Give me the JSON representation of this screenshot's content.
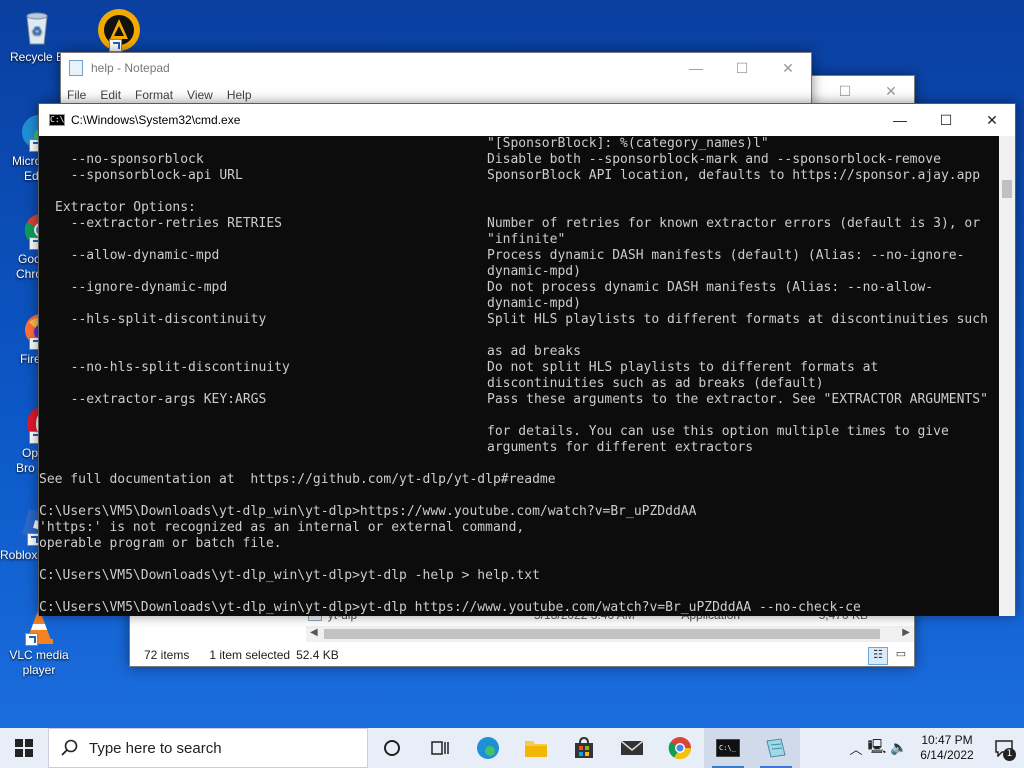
{
  "desktop": {
    "icons": [
      {
        "label": "Recycle Bin",
        "short": "Recycle B"
      },
      {
        "label": "Microsoft Edge",
        "short1": "Micro",
        "short2": "Ed"
      },
      {
        "label": "Google Chrome",
        "short1": "Goo",
        "short2": "Chro"
      },
      {
        "label": "Firefox",
        "short": "Fire"
      },
      {
        "label": "Opera Browser",
        "short1": "Op",
        "short2": "Bro"
      },
      {
        "label": "Roblox",
        "short": "Roblox"
      },
      {
        "label": "VLC media player",
        "short1": "VLC media",
        "short2": "player"
      }
    ]
  },
  "notepad": {
    "title": "help - Notepad",
    "menu": [
      "File",
      "Edit",
      "Format",
      "View",
      "Help"
    ]
  },
  "explorer": {
    "file_row": {
      "name": "yt-dlp",
      "date": "5/18/2022 3:40 AM",
      "type": "Application",
      "size": "5,470 KB"
    },
    "status": {
      "items": "72 items",
      "selected": "1 item selected",
      "size": "52.4 KB"
    }
  },
  "cmd": {
    "title": "C:\\Windows\\System32\\cmd.exe",
    "lines": [
      {
        "left": "",
        "right": "\"[SponsorBlock]: %(category_names)l\""
      },
      {
        "left": "  --no-sponsorblock",
        "right": "Disable both --sponsorblock-mark and --sponsorblock-remove"
      },
      {
        "left": "  --sponsorblock-api URL",
        "right": "SponsorBlock API location, defaults to https://sponsor.ajay.app"
      },
      {
        "left": "",
        "right": ""
      },
      {
        "left": "Extractor Options:",
        "right": ""
      },
      {
        "left": "  --extractor-retries RETRIES",
        "right": "Number of retries for known extractor errors (default is 3), or"
      },
      {
        "left": "",
        "right": "\"infinite\""
      },
      {
        "left": "  --allow-dynamic-mpd",
        "right": "Process dynamic DASH manifests (default) (Alias: --no-ignore-"
      },
      {
        "left": "",
        "right": "dynamic-mpd)"
      },
      {
        "left": "  --ignore-dynamic-mpd",
        "right": "Do not process dynamic DASH manifests (Alias: --no-allow-"
      },
      {
        "left": "",
        "right": "dynamic-mpd)"
      },
      {
        "left": "  --hls-split-discontinuity",
        "right": "Split HLS playlists to different formats at discontinuities such"
      },
      {
        "left": "",
        "right": ""
      },
      {
        "left": "",
        "right": "as ad breaks"
      },
      {
        "left": "  --no-hls-split-discontinuity",
        "right": "Do not split HLS playlists to different formats at"
      },
      {
        "left": "",
        "right": "discontinuities such as ad breaks (default)"
      },
      {
        "left": "  --extractor-args KEY:ARGS",
        "right": "Pass these arguments to the extractor. See \"EXTRACTOR ARGUMENTS\""
      },
      {
        "left": "",
        "right": ""
      },
      {
        "left": "",
        "right": "for details. You can use this option multiple times to give"
      },
      {
        "left": "",
        "right": "arguments for different extractors"
      }
    ],
    "doc_line": "See full documentation at  https://github.com/yt-dlp/yt-dlp#readme",
    "prompt1": "C:\\Users\\VM5\\Downloads\\yt-dlp_win\\yt-dlp>https://www.youtube.com/watch?v=Br_uPZDddAA",
    "error1": "'https:' is not recognized as an internal or external command,",
    "error2": "operable program or batch file.",
    "prompt2": "C:\\Users\\VM5\\Downloads\\yt-dlp_win\\yt-dlp>yt-dlp -help > help.txt",
    "prompt3": "C:\\Users\\VM5\\Downloads\\yt-dlp_win\\yt-dlp>yt-dlp https://www.youtube.com/watch?v=Br_uPZDddAA --no-check-ce"
  },
  "taskbar": {
    "search_placeholder": "Type here to search",
    "time": "10:47 PM",
    "date": "6/14/2022",
    "notification_count": "1"
  }
}
